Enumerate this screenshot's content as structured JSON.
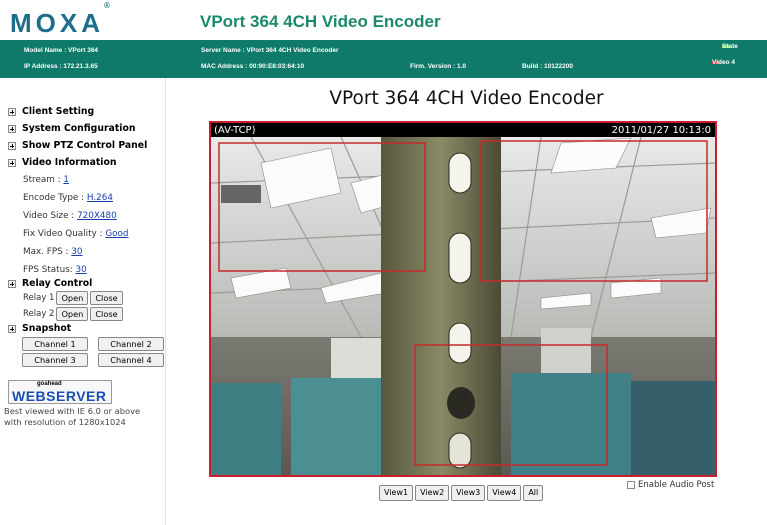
{
  "header": {
    "logo": "MOXA",
    "logo_mark": "®",
    "product_title": "VPort 364 4CH Video Encoder"
  },
  "infobar": {
    "model_name": "Model Name : VPort 364",
    "ip_address": "IP Address : 172.21.3.65",
    "server_name": "Server Name : VPort 364 4CH Video Encoder",
    "mac_address": "MAC Address : 00:90:E8:03:64:10",
    "firm_version": "Firm. Version : 1.0",
    "build": "Build : 10122200",
    "state_label": "State",
    "video_label": "Video 4",
    "colors": {
      "state": "#6ad05a",
      "video": "#d04040",
      "bar": "#0f7a6a"
    }
  },
  "sidebar": {
    "client_setting": "Client Setting",
    "system_configuration": "System Configuration",
    "ptz_panel": "Show PTZ Control Panel",
    "video_information": "Video Information",
    "stream_label": "Stream : ",
    "stream_value": "1",
    "encode_label": "Encode Type : ",
    "encode_value": "H.264",
    "size_label": "Video Size : ",
    "size_value": "720X480",
    "quality_label": "Fix Video Quality : ",
    "quality_value": "Good",
    "maxfps_label": "Max. FPS : ",
    "maxfps_value": "30",
    "fpsstatus_label": "FPS Status: ",
    "fpsstatus_value": "30",
    "relay_control": "Relay Control",
    "relay1_label": "Relay 1",
    "relay2_label": "Relay 2",
    "open_label": "Open",
    "close_label": "Close",
    "snapshot": "Snapshot",
    "channels": [
      "Channel 1",
      "Channel 2",
      "Channel 3",
      "Channel 4"
    ],
    "webserver_small": "goahead",
    "webserver_text": "WEBSERVER",
    "best_viewed_line1": "Best viewed with IE 6.0 or above",
    "best_viewed_line2": "with resolution of 1280x1024"
  },
  "main": {
    "title": "VPort 364 4CH Video Encoder",
    "protocol": "(AV-TCP)",
    "timestamp": "2011/01/27 10:13:0",
    "views": [
      "View1",
      "View2",
      "View3",
      "View4",
      "All"
    ],
    "audio_label": "Enable Audio Post",
    "frame_color": "#c81f2a"
  }
}
